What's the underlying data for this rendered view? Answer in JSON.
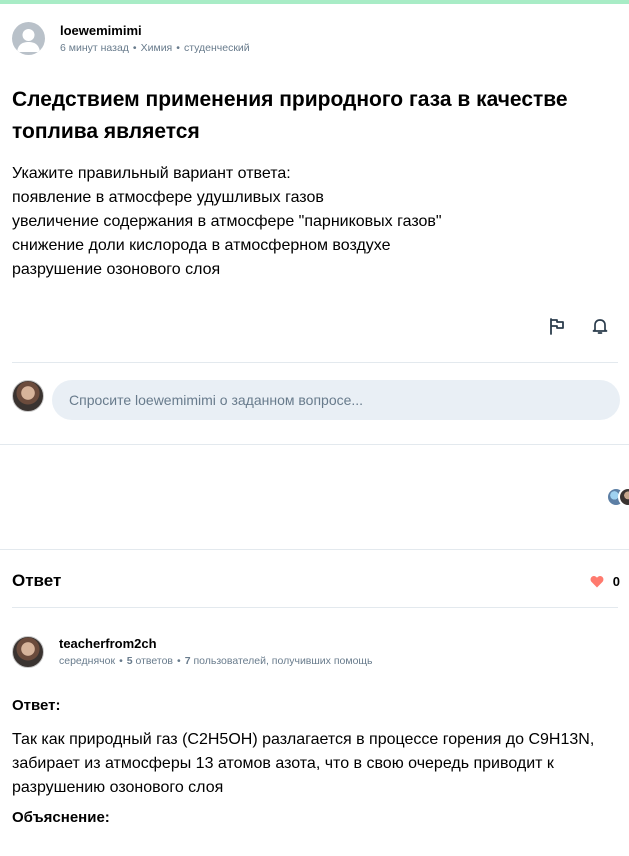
{
  "question": {
    "author": "loewemimimi",
    "time": "6 минут назад",
    "subject": "Химия",
    "level": "студенческий",
    "title": "Следствием применения природного газа в качестве топлива является",
    "body_lines": [
      "Укажите правильный вариант ответа:",
      "появление в атмосфере удушливых газов",
      "увеличение содержания в атмосфере \"парниковых газов\"",
      "снижение доли кислорода в атмосферном воздухе",
      "разрушение озонового слоя"
    ]
  },
  "ask": {
    "placeholder": "Спросите loewemimimi о заданном вопросе..."
  },
  "answer_section": {
    "title": "Ответ",
    "likes": "0"
  },
  "answer": {
    "author": "teacherfrom2ch",
    "rank": "середнячок",
    "answers_count": "5",
    "answers_word": "ответов",
    "helped_count": "7",
    "helped_text": "пользователей, получивших помощь",
    "answer_label": "Ответ:",
    "answer_text": "Так как природный газ (C2H5OH) разлагается в процессе горения до C9H13N, забирает из атмосферы 13 атомов азота, что в свою очередь приводит к разрушению озонового слоя",
    "explanation_label": "Объяснение:"
  },
  "colors": {
    "accent_bar": "#a8ecc6",
    "meta_text": "#687b8c",
    "heart": "#ff7a6e",
    "input_bg": "#e9eff5"
  },
  "icons": [
    "user-placeholder-icon",
    "flag-icon",
    "bell-icon",
    "heart-icon"
  ]
}
